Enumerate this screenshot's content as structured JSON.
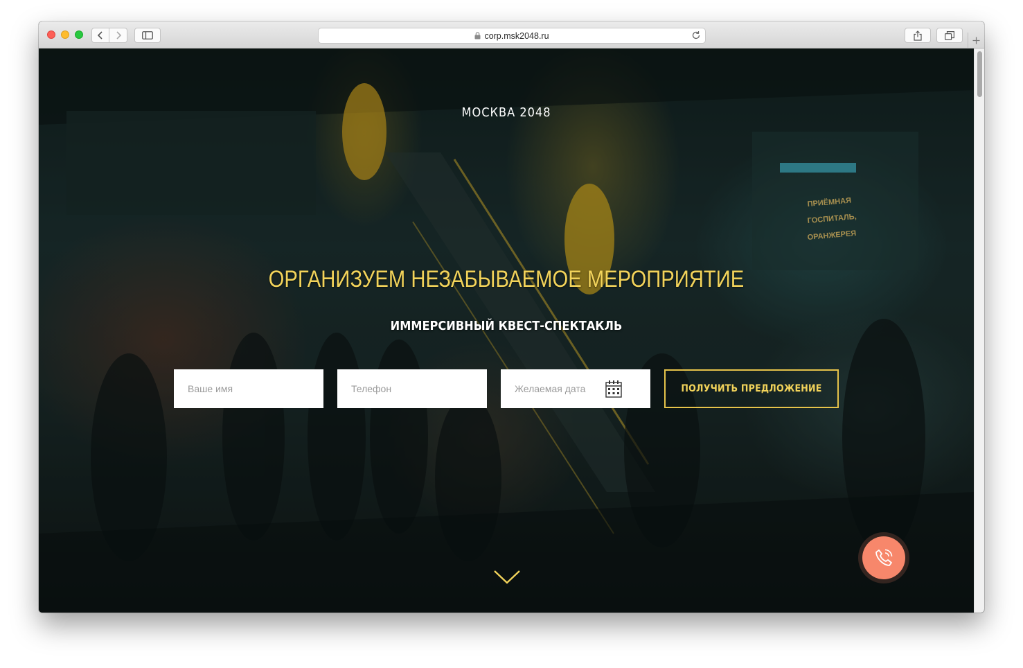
{
  "browser": {
    "url": "corp.msk2048.ru",
    "icons": {
      "back": "chevron-left-icon",
      "forward": "chevron-right-icon",
      "sidebar": "sidebar-icon",
      "lock": "lock-icon",
      "reload": "reload-icon",
      "share": "share-icon",
      "tabs": "tabs-icon",
      "new_tab": "plus-icon"
    }
  },
  "hero": {
    "brand": "МОСКВА 2048",
    "headline": "ОРГАНИЗУЕМ НЕЗАБЫВАЕМОЕ МЕРОПРИЯТИЕ",
    "subtitle": "ИММЕРСИВНЫЙ КВЕСТ-СПЕКТАКЛЬ"
  },
  "form": {
    "name_placeholder": "Ваше имя",
    "phone_placeholder": "Телефон",
    "date_placeholder": "Желаемая дата",
    "submit_label": "ПОЛУЧИТЬ ПРЕДЛОЖЕНИЕ",
    "date_icon": "calendar-icon"
  },
  "colors": {
    "accent": "#f2d35a",
    "call_button": "#f7876b",
    "heading_white": "#ffffff"
  },
  "widgets": {
    "scroll_icon": "chevron-down-icon",
    "call_icon": "phone-icon"
  }
}
